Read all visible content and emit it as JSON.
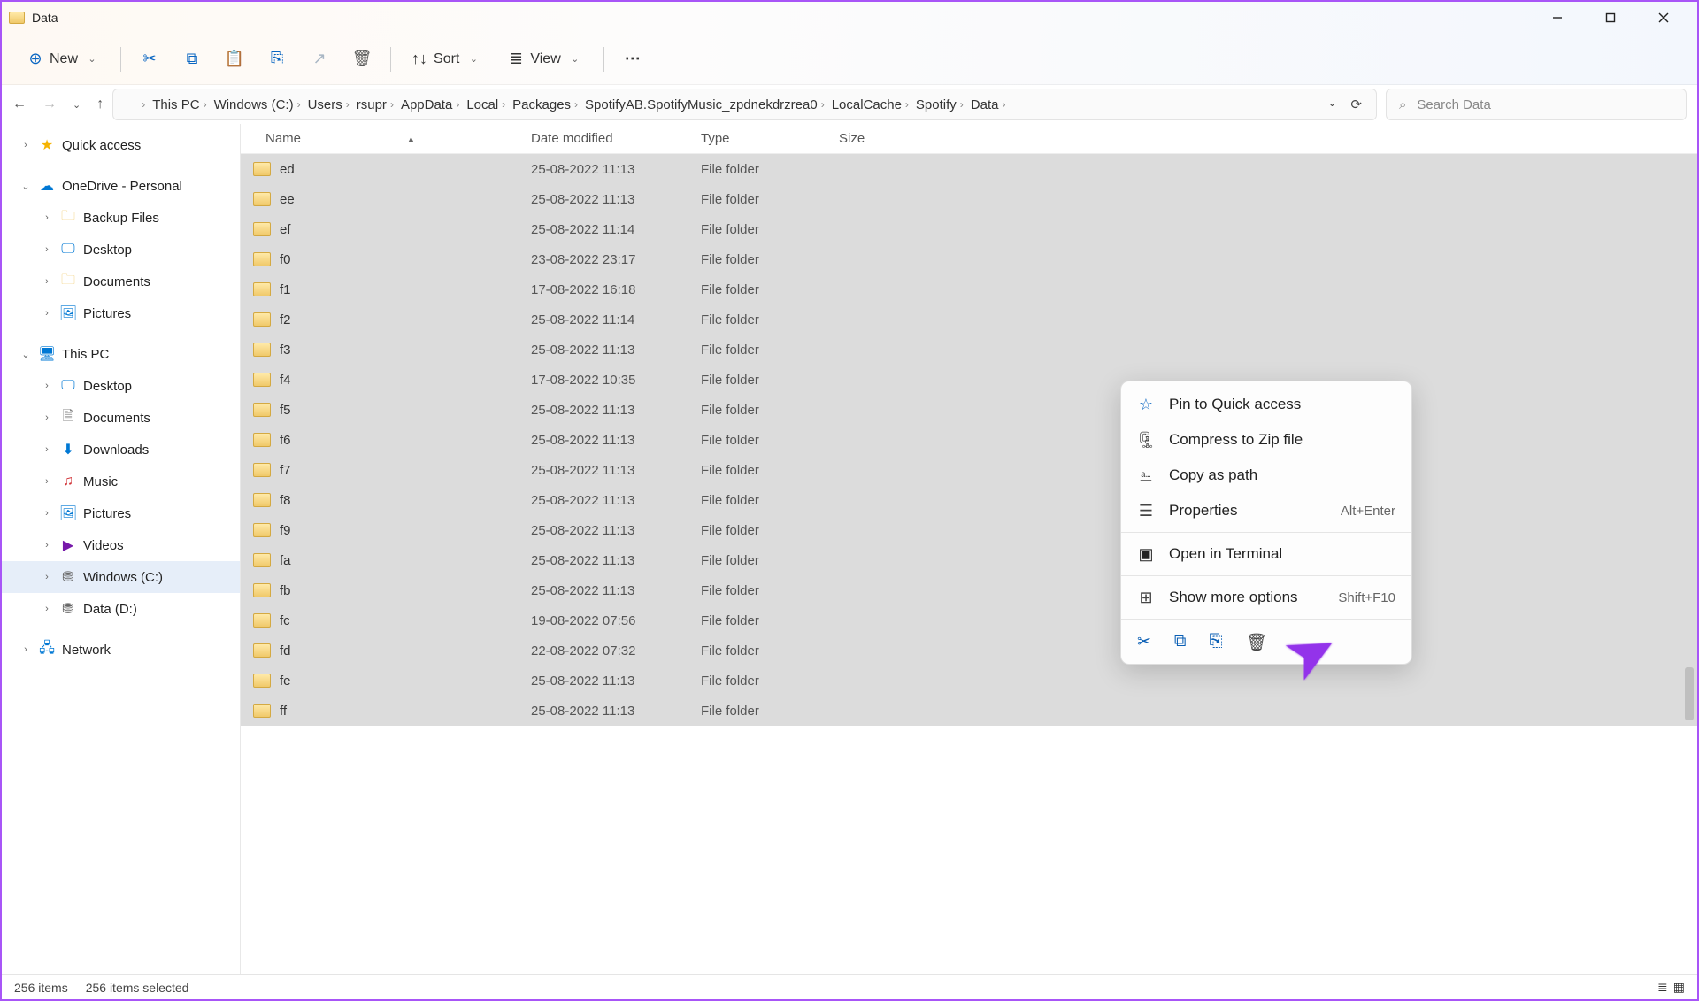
{
  "window": {
    "title": "Data"
  },
  "toolbar": {
    "new": "New",
    "sort": "Sort",
    "view": "View"
  },
  "breadcrumb": [
    "This PC",
    "Windows (C:)",
    "Users",
    "rsupr",
    "AppData",
    "Local",
    "Packages",
    "SpotifyAB.SpotifyMusic_zpdnekdrzrea0",
    "LocalCache",
    "Spotify",
    "Data"
  ],
  "search": {
    "placeholder": "Search Data"
  },
  "sidebar": {
    "quick": "Quick access",
    "onedrive": "OneDrive - Personal",
    "od_items": [
      "Backup Files",
      "Desktop",
      "Documents",
      "Pictures"
    ],
    "thispc": "This PC",
    "pc_items": [
      "Desktop",
      "Documents",
      "Downloads",
      "Music",
      "Pictures",
      "Videos",
      "Windows (C:)",
      "Data (D:)"
    ],
    "network": "Network"
  },
  "columns": {
    "name": "Name",
    "date": "Date modified",
    "type": "Type",
    "size": "Size"
  },
  "files": [
    {
      "n": "ed",
      "d": "25-08-2022 11:13",
      "t": "File folder"
    },
    {
      "n": "ee",
      "d": "25-08-2022 11:13",
      "t": "File folder"
    },
    {
      "n": "ef",
      "d": "25-08-2022 11:14",
      "t": "File folder"
    },
    {
      "n": "f0",
      "d": "23-08-2022 23:17",
      "t": "File folder"
    },
    {
      "n": "f1",
      "d": "17-08-2022 16:18",
      "t": "File folder"
    },
    {
      "n": "f2",
      "d": "25-08-2022 11:14",
      "t": "File folder"
    },
    {
      "n": "f3",
      "d": "25-08-2022 11:13",
      "t": "File folder"
    },
    {
      "n": "f4",
      "d": "17-08-2022 10:35",
      "t": "File folder"
    },
    {
      "n": "f5",
      "d": "25-08-2022 11:13",
      "t": "File folder"
    },
    {
      "n": "f6",
      "d": "25-08-2022 11:13",
      "t": "File folder"
    },
    {
      "n": "f7",
      "d": "25-08-2022 11:13",
      "t": "File folder"
    },
    {
      "n": "f8",
      "d": "25-08-2022 11:13",
      "t": "File folder"
    },
    {
      "n": "f9",
      "d": "25-08-2022 11:13",
      "t": "File folder"
    },
    {
      "n": "fa",
      "d": "25-08-2022 11:13",
      "t": "File folder"
    },
    {
      "n": "fb",
      "d": "25-08-2022 11:13",
      "t": "File folder"
    },
    {
      "n": "fc",
      "d": "19-08-2022 07:56",
      "t": "File folder"
    },
    {
      "n": "fd",
      "d": "22-08-2022 07:32",
      "t": "File folder"
    },
    {
      "n": "fe",
      "d": "25-08-2022 11:13",
      "t": "File folder"
    },
    {
      "n": "ff",
      "d": "25-08-2022 11:13",
      "t": "File folder"
    }
  ],
  "context": {
    "pin": "Pin to Quick access",
    "zip": "Compress to Zip file",
    "copypath": "Copy as path",
    "props": "Properties",
    "props_sc": "Alt+Enter",
    "terminal": "Open in Terminal",
    "more": "Show more options",
    "more_sc": "Shift+F10"
  },
  "status": {
    "count": "256 items",
    "selected": "256 items selected"
  }
}
